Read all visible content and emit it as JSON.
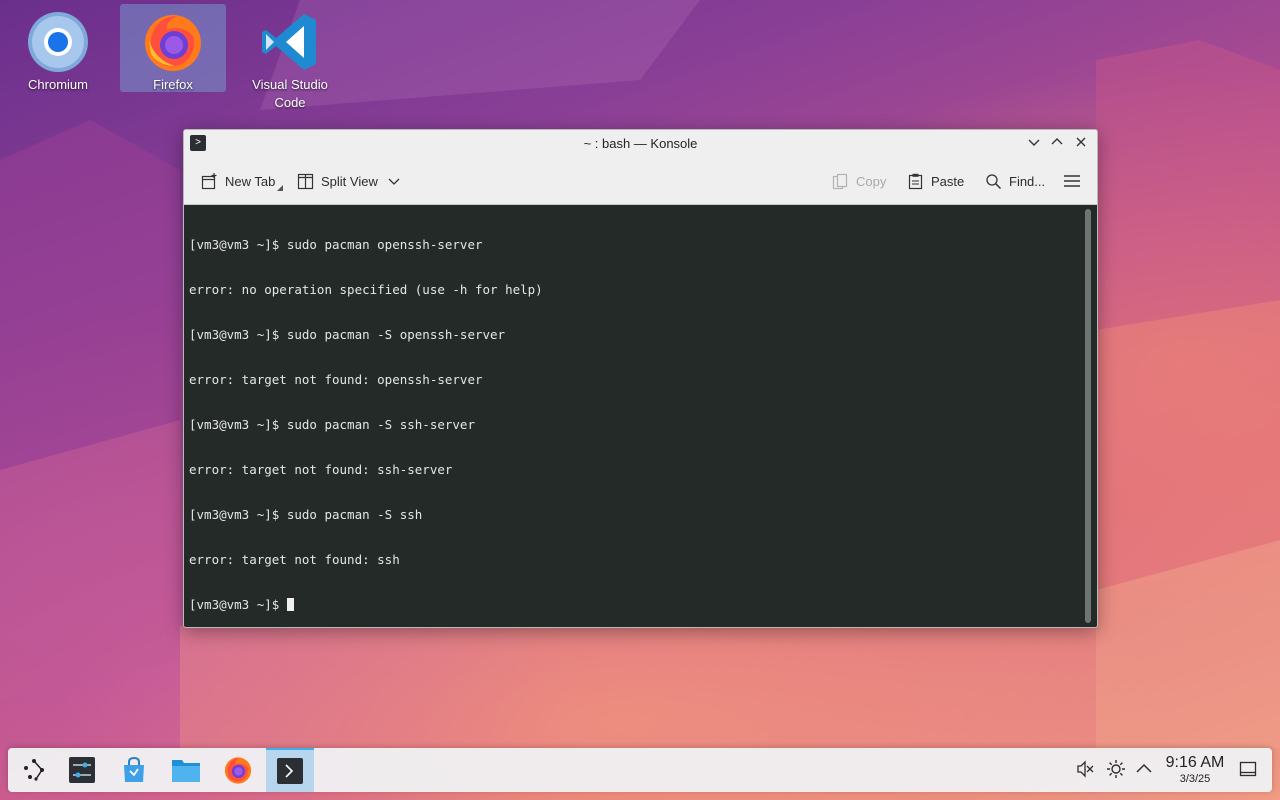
{
  "desktop": {
    "icons": [
      {
        "label": "Chromium"
      },
      {
        "label": "Firefox"
      },
      {
        "label": "Visual Studio Code"
      }
    ]
  },
  "window": {
    "title": "~ : bash — Konsole",
    "toolbar": {
      "new_tab": "New Tab",
      "split_view": "Split View",
      "copy": "Copy",
      "paste": "Paste",
      "find": "Find..."
    }
  },
  "terminal": {
    "lines": [
      "[vm3@vm3 ~]$ sudo pacman openssh-server",
      "error: no operation specified (use -h for help)",
      "[vm3@vm3 ~]$ sudo pacman -S openssh-server",
      "error: target not found: openssh-server",
      "[vm3@vm3 ~]$ sudo pacman -S ssh-server",
      "error: target not found: ssh-server",
      "[vm3@vm3 ~]$ sudo pacman -S ssh",
      "error: target not found: ssh"
    ],
    "prompt": "[vm3@vm3 ~]$ "
  },
  "taskbar": {
    "time": "9:16 AM",
    "date": "3/3/25"
  },
  "colors": {
    "accent": "#3daee9",
    "terminal_bg": "#232a28"
  }
}
